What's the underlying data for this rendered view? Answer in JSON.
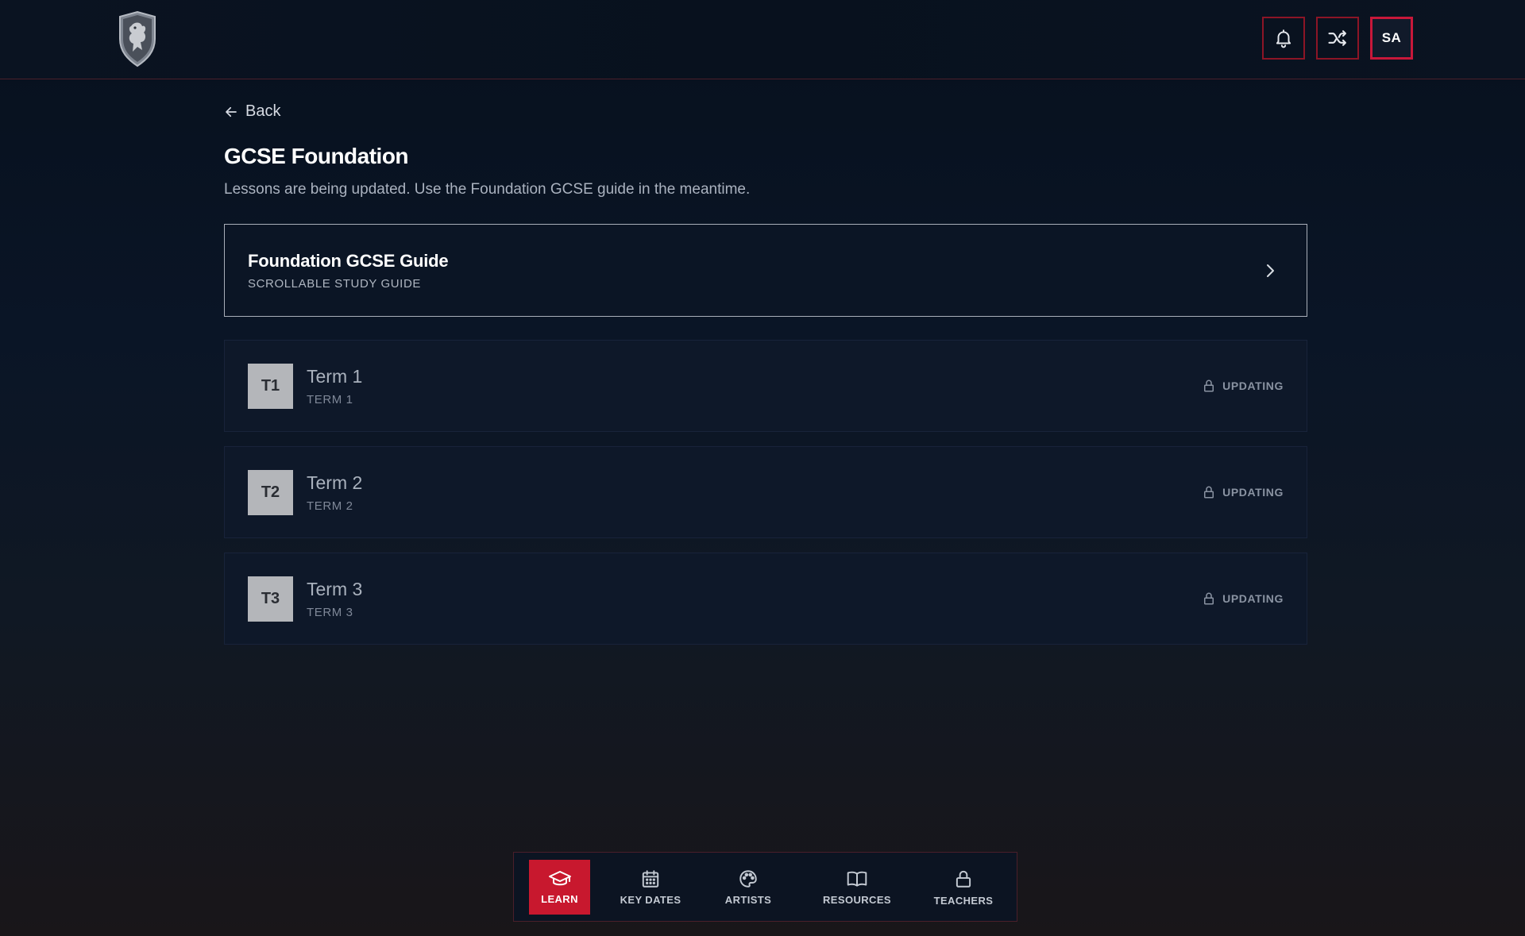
{
  "header": {
    "logo": "crest-logo",
    "notifications_icon": "bell-icon",
    "shuffle_icon": "shuffle-icon",
    "avatar_initials": "SA"
  },
  "main": {
    "back_label": "Back",
    "title": "GCSE Foundation",
    "subtitle": "Lessons are being updated. Use the Foundation GCSE guide in the meantime.",
    "guide": {
      "title": "Foundation GCSE Guide",
      "subtitle": "SCROLLABLE STUDY GUIDE"
    },
    "terms": [
      {
        "badge": "T1",
        "title": "Term 1",
        "subtitle": "TERM 1",
        "status": "UPDATING"
      },
      {
        "badge": "T2",
        "title": "Term 2",
        "subtitle": "TERM 2",
        "status": "UPDATING"
      },
      {
        "badge": "T3",
        "title": "Term 3",
        "subtitle": "TERM 3",
        "status": "UPDATING"
      }
    ]
  },
  "bottom_nav": {
    "items": [
      {
        "label": "LEARN",
        "icon": "graduation-cap-icon",
        "active": true
      },
      {
        "label": "KEY DATES",
        "icon": "calendar-icon",
        "active": false
      },
      {
        "label": "ARTISTS",
        "icon": "palette-icon",
        "active": false
      },
      {
        "label": "RESOURCES",
        "icon": "book-icon",
        "active": false
      },
      {
        "label": "TEACHERS",
        "icon": "lock-icon",
        "active": false
      }
    ]
  },
  "colors": {
    "accent": "#c8182e",
    "background": "#0a1526",
    "card": "#0e1829",
    "badge": "#b4b6ba"
  }
}
